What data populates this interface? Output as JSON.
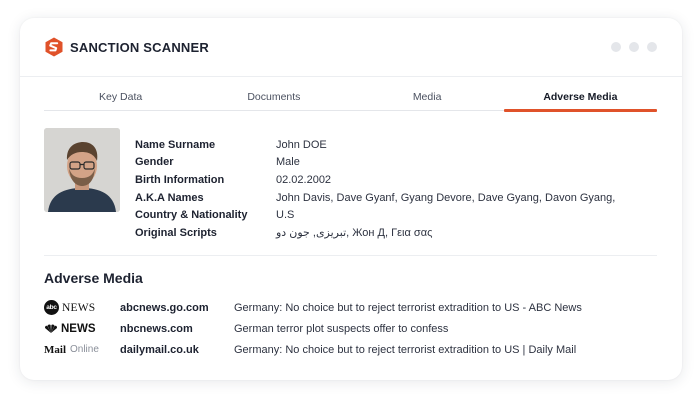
{
  "brand": {
    "name": "SANCTION SCANNER",
    "accent_color": "#e0522a"
  },
  "tabs": [
    {
      "label": "Key Data",
      "active": false
    },
    {
      "label": "Documents",
      "active": false
    },
    {
      "label": "Media",
      "active": false
    },
    {
      "label": "Adverse Media",
      "active": true
    }
  ],
  "profile": {
    "photo_icon": "profile-photo",
    "fields": [
      {
        "label": "Name Surname",
        "value": "John DOE"
      },
      {
        "label": "Gender",
        "value": "Male"
      },
      {
        "label": "Birth Information",
        "value": "02.02.2002"
      },
      {
        "label": "A.K.A Names",
        "value": "John Davis, Dave Gyanf, Gyang Devore, Dave Gyang, Davon Gyang,"
      },
      {
        "label": "Country & Nationality",
        "value": "U.S"
      },
      {
        "label": "Original Scripts",
        "value": "تبریزی, جون دو, Жон Д, Γεια σας"
      }
    ]
  },
  "adverse_media": {
    "title": "Adverse Media",
    "items": [
      {
        "source_logo": "abc-news-logo",
        "logo_text": "abc",
        "logo_word": "NEWS",
        "domain": "abcnews.go.com",
        "headline": "Germany: No choice but to reject terrorist extradition to US - ABC News"
      },
      {
        "source_logo": "nbc-news-logo",
        "logo_word": "NEWS",
        "domain": "nbcnews.com",
        "headline": "German terror plot suspects offer to confess"
      },
      {
        "source_logo": "mail-online-logo",
        "logo_word": "Mail",
        "logo_suffix": "Online",
        "domain": "dailymail.co.uk",
        "headline": "Germany: No choice but to reject terrorist extradition to US | Daily Mail"
      }
    ]
  }
}
